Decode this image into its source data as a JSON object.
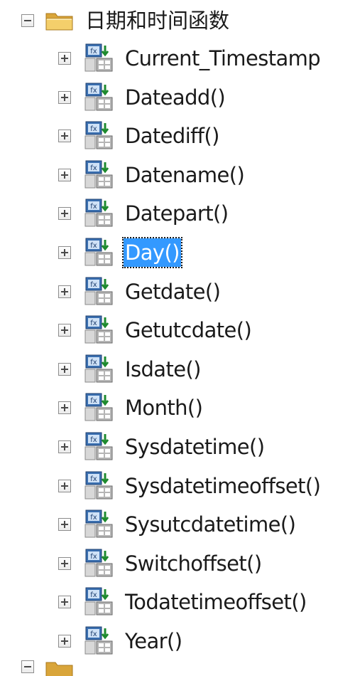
{
  "tree": {
    "folder": {
      "label": "日期和时间函数",
      "expanded": true,
      "icon": "folder-icon"
    },
    "selected_index": 5,
    "functions": [
      {
        "label": "Current_Timestamp"
      },
      {
        "label": "Dateadd()"
      },
      {
        "label": "Datediff()"
      },
      {
        "label": "Datename()"
      },
      {
        "label": "Datepart()"
      },
      {
        "label": "Day()"
      },
      {
        "label": "Getdate()"
      },
      {
        "label": "Getutcdate()"
      },
      {
        "label": "Isdate()"
      },
      {
        "label": "Month()"
      },
      {
        "label": "Sysdatetime()"
      },
      {
        "label": "Sysdatetimeoffset()"
      },
      {
        "label": "Sysutcdatetime()"
      },
      {
        "label": "Switchoffset()"
      },
      {
        "label": "Todatetimeoffset()"
      },
      {
        "label": "Year()"
      }
    ],
    "function_icon": "scalar-function-icon",
    "colors": {
      "selection": "#3399ff",
      "folder": "#e8b84a"
    }
  }
}
